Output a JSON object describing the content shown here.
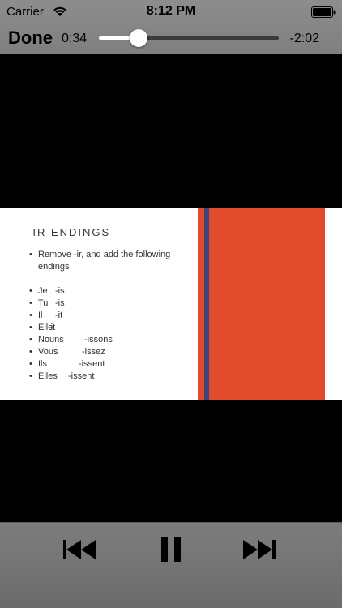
{
  "status_bar": {
    "carrier": "Carrier",
    "time": "8:12 PM",
    "wifi_icon": "wifi-icon",
    "battery_icon": "battery-full-icon"
  },
  "player": {
    "done_label": "Done",
    "elapsed": "0:34",
    "remaining": "-2:02",
    "progress_fraction": 0.22
  },
  "slide": {
    "title": "-IR ENDINGS",
    "intro": "Remove -ir, and add the following endings",
    "bullet": "•",
    "endings": [
      {
        "pronoun": "Je",
        "suffix": "-is"
      },
      {
        "pronoun": "Tu",
        "suffix": "-is"
      },
      {
        "pronoun": "Il",
        "suffix": "-it"
      },
      {
        "pronoun": "Elle",
        "suffix": "-it"
      },
      {
        "pronoun": "Nouns",
        "suffix": "-issons"
      },
      {
        "pronoun": "Vous",
        "suffix": "-issez"
      },
      {
        "pronoun": "Ils",
        "suffix": "-issent"
      },
      {
        "pronoun": "Elles",
        "suffix": "-issent"
      }
    ],
    "colors": {
      "orange": "#e14b2c",
      "navy": "#3c4576"
    }
  },
  "transport": {
    "previous_icon": "skip-back-icon",
    "pause_icon": "pause-icon",
    "next_icon": "skip-forward-icon"
  }
}
